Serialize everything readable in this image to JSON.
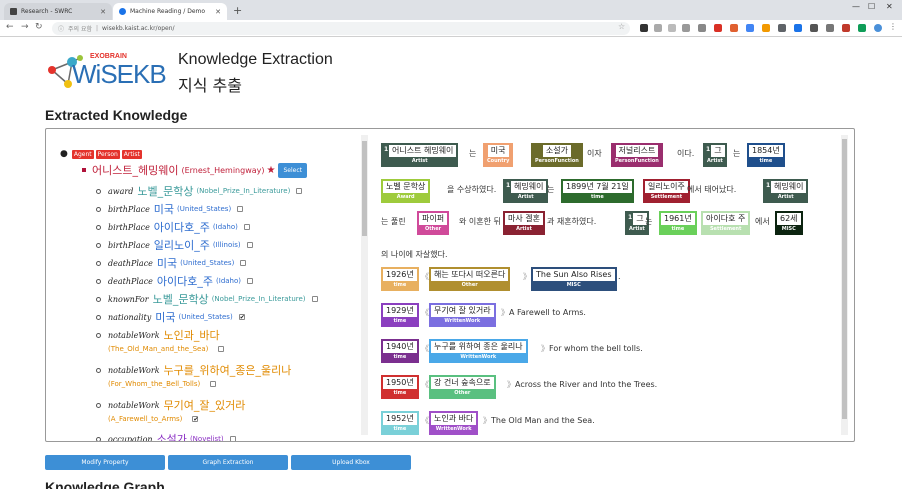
{
  "browser": {
    "tabs": [
      {
        "title": "Research - SWRC"
      },
      {
        "title": "Machine Reading / Demo"
      }
    ],
    "url": "wisekb.kaist.ac.kr/open/",
    "security": "주의 요함"
  },
  "header": {
    "logo_small": "EXOBRAIN",
    "logo_main": "WiSEKB",
    "title_en": "Knowledge Extraction",
    "title_ko": "지식 추출"
  },
  "section_title": "Extracted Knowledge",
  "section_title2": "Knowledge Graph",
  "tree": {
    "types": [
      "Agent",
      "Person",
      "Artist"
    ],
    "entity": {
      "name": "어니스트_헤밍웨이",
      "id": "(Ernest_Hemingway)",
      "star": "★"
    },
    "select_label": "Select",
    "props": [
      {
        "pred": "award",
        "val": "노벨_문학상",
        "id": "(Nobel_Prize_In_Literature)",
        "color": "#3a9a9a",
        "checked": false
      },
      {
        "pred": "birthPlace",
        "val": "미국",
        "id": "(United_States)",
        "color": "#2d6ccf",
        "checked": false
      },
      {
        "pred": "birthPlace",
        "val": "아이다호_주",
        "id": "(Idaho)",
        "color": "#2d6ccf",
        "checked": false
      },
      {
        "pred": "birthPlace",
        "val": "일리노이_주",
        "id": "(Illinois)",
        "color": "#2d6ccf",
        "checked": false
      },
      {
        "pred": "deathPlace",
        "val": "미국",
        "id": "(United_States)",
        "color": "#2d6ccf",
        "checked": false
      },
      {
        "pred": "deathPlace",
        "val": "아이다호_주",
        "id": "(Idaho)",
        "color": "#2d6ccf",
        "checked": false
      },
      {
        "pred": "knownFor",
        "val": "노벨_문학상",
        "id": "(Nobel_Prize_In_Literature)",
        "color": "#3a9a9a",
        "checked": false
      },
      {
        "pred": "nationality",
        "val": "미국",
        "id": "(United_States)",
        "color": "#2d6ccf",
        "checked": true
      },
      {
        "pred": "notableWork",
        "val": "노인과_바다",
        "id": "(The_Old_Man_and_the_Sea)",
        "color": "#e08a00",
        "checked": false
      },
      {
        "pred": "notableWork",
        "val": "누구를_위하여_종은_울리나",
        "id": "(For_Whom_the_Bell_Tolls)",
        "color": "#e08a00",
        "checked": false
      },
      {
        "pred": "notableWork",
        "val": "무기여_잘_있거라",
        "id": "(A_Farewell_to_Arms)",
        "color": "#e08a00",
        "checked": true
      },
      {
        "pred": "occupation",
        "val": "소설가",
        "id": "(Novelist)",
        "color": "#8b2fc4",
        "checked": false
      }
    ]
  },
  "annot": {
    "tokens": [
      {
        "w": "어니스트 헤밍웨이",
        "l": "Artist",
        "c": "#3e5b4f",
        "n": "1"
      },
      {
        "w": "미국",
        "l": "Country",
        "c": "#f0a070",
        "n": ""
      },
      {
        "w": "소설가",
        "l": "PersonFunction",
        "c": "#6b6b2a",
        "n": ""
      },
      {
        "w": "저널리스트",
        "l": "PersonFunction",
        "c": "#9a2e6e",
        "n": ""
      },
      {
        "w": "그",
        "l": "Artist",
        "c": "#3e5b4f",
        "n": "1"
      },
      {
        "w": "1854년",
        "l": "time",
        "c": "#1f4f8c",
        "n": ""
      },
      {
        "w": "노벨 문학상",
        "l": "Award",
        "c": "#9ecb3c",
        "n": ""
      },
      {
        "w": "헤밍웨이",
        "l": "Artist",
        "c": "#3e5b4f",
        "n": "1"
      },
      {
        "w": "1899년 7월 21일",
        "l": "time",
        "c": "#2d6b2d",
        "n": ""
      },
      {
        "w": "일리노이주",
        "l": "Settlement",
        "c": "#a02030",
        "n": ""
      },
      {
        "w": "헤밍웨이",
        "l": "Artist",
        "c": "#3e5b4f",
        "n": "1"
      },
      {
        "w": "파이퍼",
        "l": "Other",
        "c": "#d04a9a",
        "n": ""
      },
      {
        "w": "마사 겔혼",
        "l": "Artist",
        "c": "#8a2232",
        "n": ""
      },
      {
        "w": "그",
        "l": "Artist",
        "c": "#3e5b4f",
        "n": "1"
      },
      {
        "w": "1961년",
        "l": "time",
        "c": "#6ad05a",
        "n": ""
      },
      {
        "w": "아이다호 주",
        "l": "Settlement",
        "c": "#b8e0b0",
        "n": ""
      },
      {
        "w": "62세",
        "l": "MISC",
        "c": "#0c2410",
        "n": ""
      },
      {
        "w": "1926년",
        "l": "time",
        "c": "#e8b060",
        "n": ""
      },
      {
        "w": "해는 또다시 떠오른다",
        "l": "Other",
        "c": "#b08f2f",
        "n": ""
      },
      {
        "w": "The Sun Also Rises",
        "l": "MISC",
        "c": "#2d4f7c",
        "n": ""
      },
      {
        "w": "1929년",
        "l": "time",
        "c": "#8b3fbf",
        "n": ""
      },
      {
        "w": "무기여 잘 있거라",
        "l": "WrittenWork",
        "c": "#7b6fe0",
        "n": ""
      },
      {
        "w": "1940년",
        "l": "time",
        "c": "#7b2f8f",
        "n": ""
      },
      {
        "w": "누구를 위하여 종은 울리나",
        "l": "WrittenWork",
        "c": "#4aa8e8",
        "n": ""
      },
      {
        "w": "1950년",
        "l": "time",
        "c": "#d03030",
        "n": ""
      },
      {
        "w": "강 건너 숲속으로",
        "l": "Other",
        "c": "#5ac080",
        "n": ""
      },
      {
        "w": "1952년",
        "l": "time",
        "c": "#7ad0d8",
        "n": ""
      },
      {
        "w": "노인과 바다",
        "l": "WrittenWork",
        "c": "#a050c8",
        "n": ""
      }
    ],
    "text": {
      "t1": "는",
      "t2": "이자",
      "t3": "이다.",
      "t4": "는",
      "t5": "을 수상하였다.",
      "t6": "는",
      "t7": "에서 태어났다.",
      "t8": "는 풀린",
      "t9": "와 이혼한 뒤",
      "t10": "과 재혼하였다.",
      "t11": "는",
      "t12": "에서",
      "t13": "의 나이에 자살했다.",
      "t14": ".",
      "t15": "A Farewell to Arms.",
      "t16": "For whom the bell tolls.",
      "t17": "Across the River and Into the Trees.",
      "t18": "The Old Man and the Sea.",
      "lb": "《",
      "rb": "》"
    }
  },
  "buttons": {
    "modify": "Modify Property",
    "graph": "Graph Extraction",
    "upload": "Upload Kbox"
  }
}
